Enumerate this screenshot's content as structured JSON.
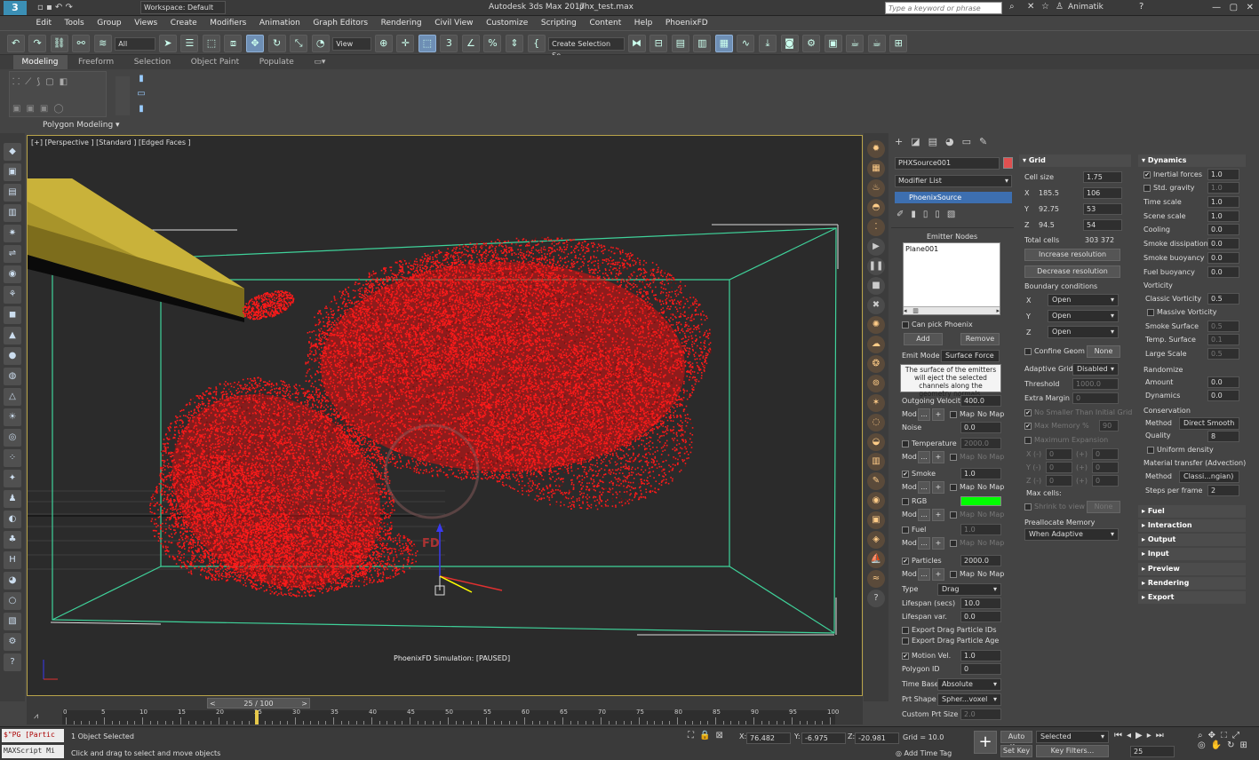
{
  "window": {
    "title": "Autodesk 3ds Max 2017",
    "file": "phx_test.max",
    "workspace": "Workspace: Default",
    "search_placeholder": "Type a keyword or phrase",
    "user": "Animatik"
  },
  "menu": [
    "Edit",
    "Tools",
    "Group",
    "Views",
    "Create",
    "Modifiers",
    "Animation",
    "Graph Editors",
    "Rendering",
    "Civil View",
    "Customize",
    "Scripting",
    "Content",
    "Help",
    "PhoenixFD"
  ],
  "toolbar": {
    "filter": "All",
    "refcoord": "View",
    "selection_set": "Create Selection Se"
  },
  "ribbon": {
    "tabs": [
      "Modeling",
      "Freeform",
      "Selection",
      "Object Paint",
      "Populate"
    ],
    "panel_label": "Polygon Modeling"
  },
  "viewport": {
    "label": "[+] [Perspective ] [Standard ] [Edged Faces ]",
    "status": "PhoenixFD Simulation: [PAUSED]",
    "logo_text": "FD"
  },
  "command_panel": {
    "object_name": "PHXSource001",
    "object_color": "#e05050",
    "modifier_list": "Modifier List",
    "modifier": "PhoenixSource",
    "emitter_nodes_title": "Emitter Nodes",
    "emitter_node": "Plane001",
    "can_pick": "Can pick Phoenix",
    "add": "Add",
    "remove": "Remove",
    "emit_mode_label": "Emit Mode",
    "emit_mode": "Surface Force",
    "info": "The surface of the emitters will eject the selected channels along the geometry normals.",
    "outgoing_velocity_label": "Outgoing Velocity",
    "outgoing_velocity": "400.0",
    "mod": "Mod",
    "dots": "...",
    "plus": "+",
    "map": "Map",
    "no_map": "No Map",
    "noise_label": "Noise",
    "noise": "0.0",
    "temperature_label": "Temperature",
    "temperature": "2000.0",
    "smoke_label": "Smoke",
    "smoke": "1.0",
    "rgb_label": "RGB",
    "rgb_color": "#00ff00",
    "fuel_label": "Fuel",
    "fuel": "1.0",
    "particles_label": "Particles",
    "particles": "2000.0",
    "type_label": "Type",
    "type": "Drag",
    "lifespan_label": "Lifespan (secs)",
    "lifespan": "10.0",
    "lifespan_var_label": "Lifespan var.",
    "lifespan_var": "0.0",
    "export_ids": "Export Drag Particle IDs",
    "export_age": "Export Drag Particle Age",
    "motion_vel_label": "Motion Vel.",
    "motion_vel": "1.0",
    "polygon_id_label": "Polygon ID",
    "polygon_id": "0",
    "time_base_label": "Time Base",
    "time_base": "Absolute",
    "prt_shape_label": "Prt Shape",
    "prt_shape": "Spher...voxel",
    "custom_prt_size_label": "Custom Prt Size",
    "custom_prt_size": "2.0"
  },
  "grid": {
    "title": "Grid",
    "cell_size_label": "Cell size",
    "cell_size": "1.75",
    "x_label": "X",
    "x_size": "185.5",
    "x_cells": "106",
    "y_label": "Y",
    "y_size": "92.75",
    "y_cells": "53",
    "z_label": "Z",
    "z_size": "94.5",
    "z_cells": "54",
    "total_cells_label": "Total cells",
    "total_cells": "303 372",
    "increase": "Increase resolution",
    "decrease": "Decrease resolution",
    "boundary_label": "Boundary conditions",
    "boundary_x": "Open",
    "boundary_y": "Open",
    "boundary_z": "Open",
    "confine_geom": "Confine Geom",
    "confine_none": "None",
    "adaptive_grid_label": "Adaptive Grid",
    "adaptive_grid": "Disabled",
    "threshold_label": "Threshold",
    "threshold": "1000.0",
    "extra_margin_label": "Extra Margin",
    "extra_margin": "0",
    "no_smaller": "No Smaller Than Initial Grid",
    "max_memory_label": "Max Memory %",
    "max_memory": "90",
    "max_expansion": "Maximum Expansion",
    "xn": "X (-)",
    "yn": "Y (-)",
    "zn": "Z (-)",
    "pos": "(+)",
    "zero": "0",
    "max_cells_label": "Max cells:",
    "shrink": "Shrink to view",
    "shrink_none": "None",
    "preallocate_label": "Preallocate Memory",
    "preallocate": "When Adaptive"
  },
  "dynamics": {
    "title": "Dynamics",
    "inertial_forces_label": "Inertial forces",
    "inertial_forces": "1.0",
    "std_gravity_label": "Std. gravity",
    "std_gravity": "1.0",
    "time_scale_label": "Time scale",
    "time_scale": "1.0",
    "scene_scale_label": "Scene scale",
    "scene_scale": "1.0",
    "cooling_label": "Cooling",
    "cooling": "0.0",
    "smoke_dissipation_label": "Smoke dissipation",
    "smoke_dissipation": "0.0",
    "smoke_buoyancy_label": "Smoke buoyancy",
    "smoke_buoyancy": "0.0",
    "fuel_buoyancy_label": "Fuel buoyancy",
    "fuel_buoyancy": "0.0",
    "vorticity_label": "Vorticity",
    "classic_vorticity_label": "Classic Vorticity",
    "classic_vorticity": "0.5",
    "massive_vorticity": "Massive Vorticity",
    "smoke_surface_label": "Smoke Surface",
    "smoke_surface": "0.5",
    "temp_surface_label": "Temp. Surface",
    "temp_surface": "0.1",
    "large_scale_label": "Large Scale",
    "large_scale": "0.5",
    "randomize_label": "Randomize",
    "amount_label": "Amount",
    "amount": "0.0",
    "rdynamics_label": "Dynamics",
    "rdynamics": "0.0",
    "conservation_label": "Conservation",
    "method_label": "Method",
    "method": "Direct Smooth",
    "quality_label": "Quality",
    "quality": "8",
    "uniform_density": "Uniform density",
    "material_transfer_label": "Material transfer (Advection)",
    "mt_method_label": "Method",
    "mt_method": "Classi...ngian)",
    "steps_label": "Steps per frame",
    "steps": "2",
    "rollouts": [
      "Fuel",
      "Interaction",
      "Output",
      "Input",
      "Preview",
      "Rendering",
      "Export"
    ]
  },
  "timeline": {
    "frame": "25 / 100",
    "ticks": [
      "0",
      "5",
      "10",
      "15",
      "20",
      "25",
      "30",
      "35",
      "40",
      "45",
      "50",
      "55",
      "60",
      "65",
      "70",
      "75",
      "80",
      "85",
      "90",
      "95",
      "100"
    ]
  },
  "status": {
    "script1": "$\"PG [Partic",
    "script2": "MAXScript Mi",
    "selected": "1 Object Selected",
    "hint": "Click and drag to select and move objects",
    "x_label": "X:",
    "x": "76.482",
    "y_label": "Y:",
    "y": "-6.975",
    "z_label": "Z:",
    "z": "-20.981",
    "grid": "Grid = 10.0",
    "add_time_tag": "Add Time Tag",
    "auto_key": "Auto Key",
    "set_key": "Set Key",
    "key_mode": "Selected",
    "key_filters": "Key Filters...",
    "frame": "25"
  }
}
